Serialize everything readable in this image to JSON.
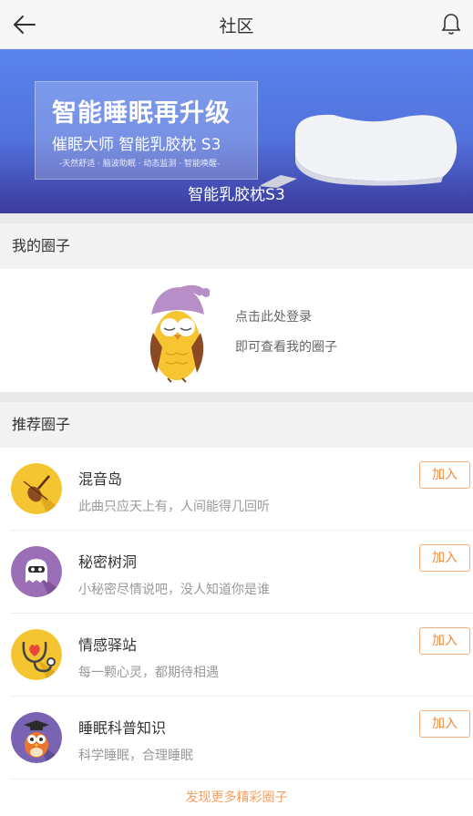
{
  "header": {
    "title": "社区",
    "back_icon": "back-arrow-icon",
    "bell_icon": "bell-icon"
  },
  "banner": {
    "promo_title": "智能睡眠再升级",
    "promo_subtitle": "催眠大师 智能乳胶枕 S3",
    "promo_features": "-天然舒适 · 脑波助眠 · 动态监测 · 智能唤醒-",
    "caption": "智能乳胶枕S3"
  },
  "my_circle": {
    "heading": "我的圈子",
    "login_line1": "点击此处登录",
    "login_line2": "即可查看我的圈子"
  },
  "recommended": {
    "heading": "推荐圈子",
    "join_label": "加入",
    "items": [
      {
        "name": "混音岛",
        "desc": "此曲只应天上有，人间能得几回听",
        "icon": "violin-icon",
        "color": "#f5c531"
      },
      {
        "name": "秘密树洞",
        "desc": "小秘密尽情说吧，没人知道你是谁",
        "icon": "ghost-icon",
        "color": "#9b6fb5"
      },
      {
        "name": "情感驿站",
        "desc": "每一颗心灵，都期待相遇",
        "icon": "heart-stethoscope-icon",
        "color": "#f5c531"
      },
      {
        "name": "睡眠科普知识",
        "desc": "科学睡眠，合理睡眠",
        "icon": "owl-graduate-icon",
        "color": "#7a63b3"
      }
    ],
    "more_label": "发现更多精彩圈子"
  }
}
